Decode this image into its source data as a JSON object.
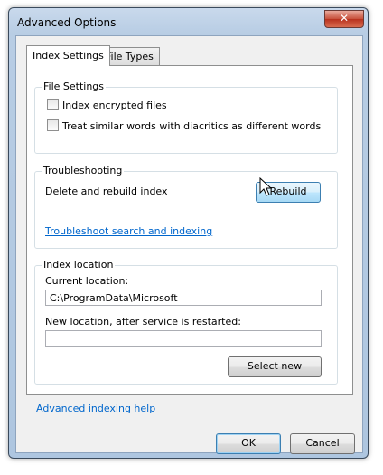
{
  "window": {
    "title": "Advanced Options",
    "close_label": "✕"
  },
  "tabs": [
    {
      "label": "Index Settings",
      "active": true
    },
    {
      "label": "File Types",
      "active": false
    }
  ],
  "file_settings": {
    "title": "File Settings",
    "options": [
      {
        "label": "Index encrypted files",
        "checked": false
      },
      {
        "label": "Treat similar words with diacritics as different words",
        "checked": false
      }
    ]
  },
  "troubleshooting": {
    "title": "Troubleshooting",
    "rebuild_text": "Delete and rebuild index",
    "rebuild_button": "Rebuild",
    "troubleshoot_link": "Troubleshoot search and indexing"
  },
  "index_location": {
    "title": "Index location",
    "current_label": "Current location:",
    "current_value": "C:\\ProgramData\\Microsoft",
    "new_label": "New location, after service is restarted:",
    "new_value": "",
    "select_button": "Select new"
  },
  "footer": {
    "help_link": "Advanced indexing help",
    "ok_button": "OK",
    "cancel_button": "Cancel"
  },
  "colors": {
    "link": "#0066cc",
    "title_bar": "#b8cde4",
    "close_button": "#c7503b"
  },
  "icons": [
    "close-icon",
    "mouse-pointer-icon"
  ]
}
